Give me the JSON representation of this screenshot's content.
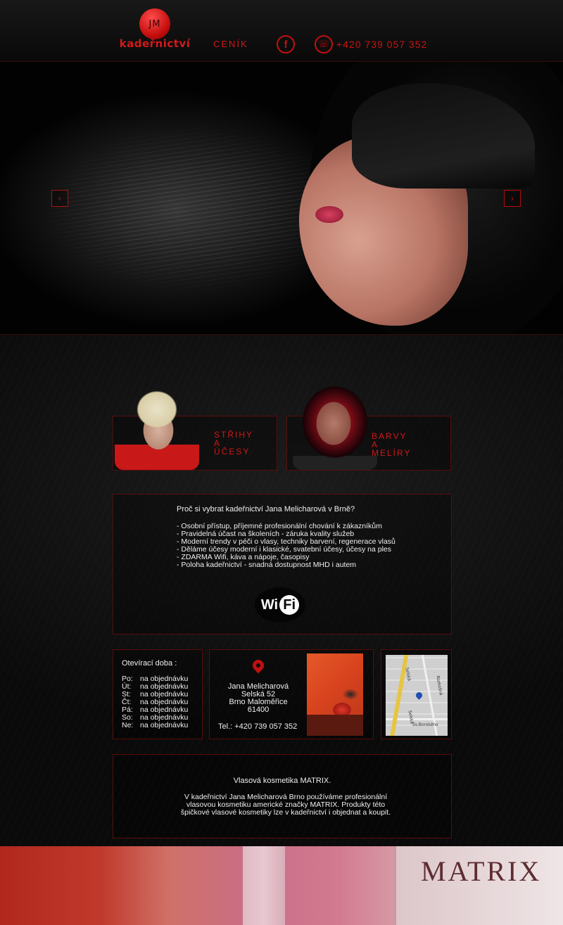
{
  "header": {
    "logo_mark": "JM",
    "logo_text": "kadeřnictví",
    "nav_cenik": "CENÍK",
    "facebook_glyph": "f",
    "phone": "+420 739 057 352",
    "phone_glyph": "☏"
  },
  "hero": {
    "prev_glyph": "‹",
    "next_glyph": "›"
  },
  "tiles": [
    {
      "label_lines": [
        "STŘIHY",
        "A",
        "ÚČESY"
      ]
    },
    {
      "label_lines": [
        "BARVY",
        "A",
        "MELÍRY"
      ]
    }
  ],
  "info": {
    "heading": "Proč si vybrat kadeřnictví Jana Melicharová v Brně?",
    "items": [
      "- Osobní přístup, příjemné profesionální chování k zákazníkům",
      "- Pravidelná účast na školeních - záruka kvality služeb",
      "- Moderní trendy v péči o vlasy, techniky barvení, regenerace vlasů",
      "- Děláme účesy moderní i klasické, svatební účesy, účesy na ples",
      "- ZDARMA Wifi, káva a nápoje, časopisy",
      "- Poloha kadeřnictví - snadná dostupnost MHD i autem"
    ],
    "wifi_left": "Wi",
    "wifi_right": "Fi"
  },
  "hours": {
    "title": "Otevírací doba :",
    "rows": [
      {
        "day": "Po:",
        "value": "na objednávku"
      },
      {
        "day": "Út:",
        "value": "na objednávku"
      },
      {
        "day": "St:",
        "value": "na objednávku"
      },
      {
        "day": "Čt:",
        "value": "na objednávku"
      },
      {
        "day": "Pá:",
        "value": "na objednávku"
      },
      {
        "day": "So:",
        "value": "na objednávku"
      },
      {
        "day": "Ne:",
        "value": "na objednávku"
      }
    ]
  },
  "contact": {
    "name": "Jana Melicharová",
    "street": "Selská 52",
    "city": "Brno Maloměřice",
    "zip": "61400",
    "phone": "Tel.: +420 739 057 352"
  },
  "map": {
    "labels": [
      "Selská",
      "Selská",
      "Sv.Borského",
      "Rozkošná"
    ]
  },
  "matrix": {
    "title": "Vlasová kosmetika MATRIX.",
    "lines": [
      "V kadeřnictví Jana Melicharová Brno používáme profesionální",
      "vlasovou kosmetiku americké značky MATRIX. Produkty této",
      "špičkové vlasové kosmetiky lze v kadeřnictví i objednat a koupit."
    ]
  },
  "footer": {
    "brand": "MATRIX"
  },
  "colors": {
    "accent": "#c81414",
    "border": "#5a0c0c",
    "background": "#0b0b0b",
    "text": "#f0f0f0"
  }
}
